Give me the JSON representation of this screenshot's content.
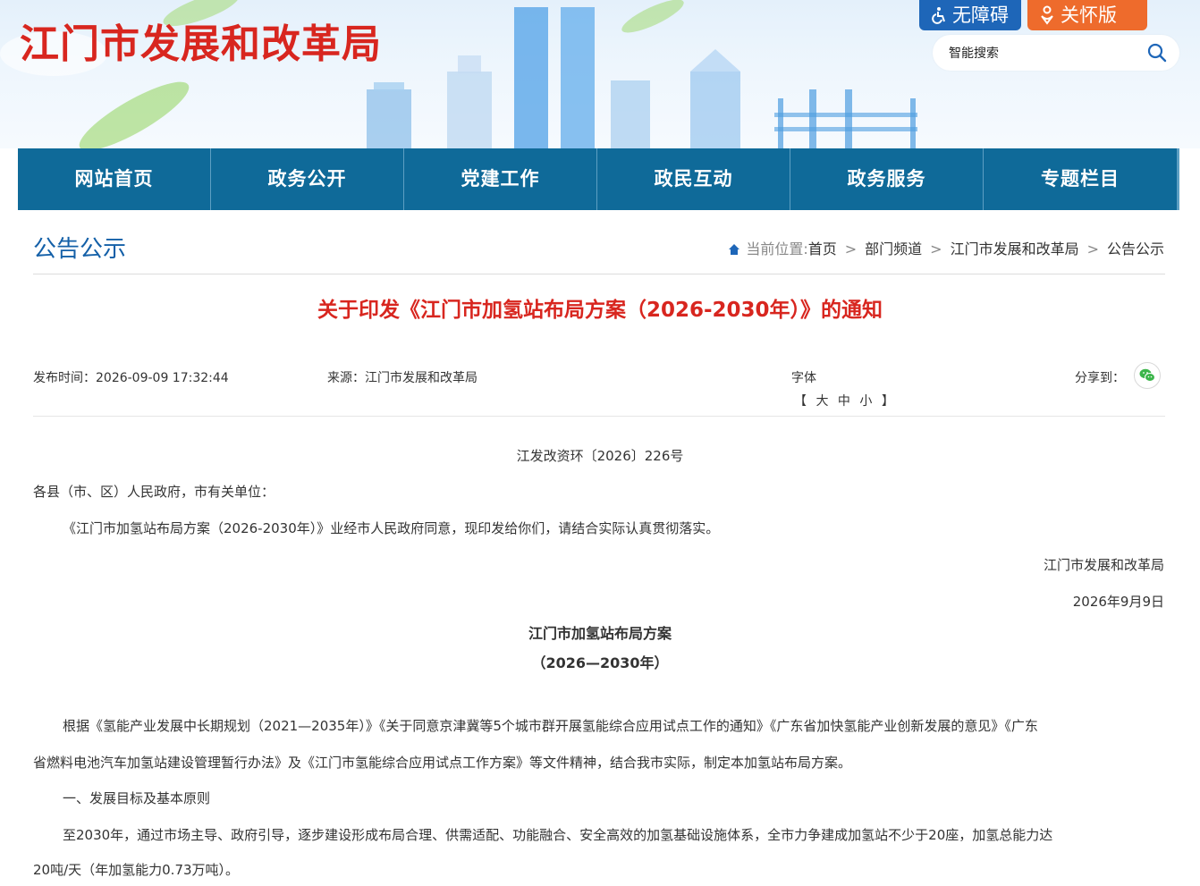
{
  "header": {
    "site_title": "江门市发展和改革局",
    "accessibility_label": "无障碍",
    "care_label": "关怀版",
    "search_placeholder": "智能搜索"
  },
  "nav": {
    "items": [
      "网站首页",
      "政务公开",
      "党建工作",
      "政民互动",
      "政务服务",
      "专题栏目"
    ]
  },
  "section": {
    "title": "公告公示",
    "breadcrumb_label": "当前位置:",
    "breadcrumb": [
      "首页",
      "部门频道",
      "江门市发展和改革局",
      "公告公示"
    ],
    "separator": ">"
  },
  "article": {
    "title": "关于印发《江门市加氢站布局方案（2026-2030年）》的通知",
    "publish_time": "发布时间：2026-09-09 17:32:44",
    "source": "来源：江门市发展和改革局",
    "font_label": "字体",
    "font_open": "【",
    "font_sizes": [
      "大",
      "中",
      "小"
    ],
    "font_close": "】",
    "share_label": "分享到：",
    "doc_number": "江发改资环〔2026〕226号",
    "salutation": "各县（市、区）人民政府，市有关单位：",
    "intro": "《江门市加氢站布局方案（2026-2030年）》业经市人民政府同意，现印发给你们，请结合实际认真贯彻落实。",
    "signature": "江门市发展和改革局",
    "date": "2026年9月9日",
    "plan_title": "江门市加氢站布局方案",
    "plan_years": "（2026—2030年）",
    "para1_line1": "根据《氢能产业发展中长期规划（2021—2035年）》《关于同意京津冀等5个城市群开展氢能综合应用试点工作的通知》《广东省加快氢能产业创新发展的意见》《广东",
    "para1_line2": "省燃料电池汽车加氢站建设管理暂行办法》及《江门市氢能综合应用试点工作方案》等文件精神，结合我市实际，制定本加氢站布局方案。",
    "heading1": "一、发展目标及基本原则",
    "para2_line1": "至2030年，通过市场主导、政府引导，逐步建设形成布局合理、供需适配、功能融合、安全高效的加氢基础设施体系，全市力争建成加氢站不少于20座，加氢总能力达",
    "para2_line2": "20吨/天（年加氢能力0.73万吨）。"
  },
  "colors": {
    "title_red": "#d8261f",
    "nav_blue": "#0f6a99",
    "section_blue": "#1460a8",
    "access_blue": "#1e66b8",
    "care_orange": "#ee6b2c",
    "wechat_green": "#3bb54a"
  }
}
